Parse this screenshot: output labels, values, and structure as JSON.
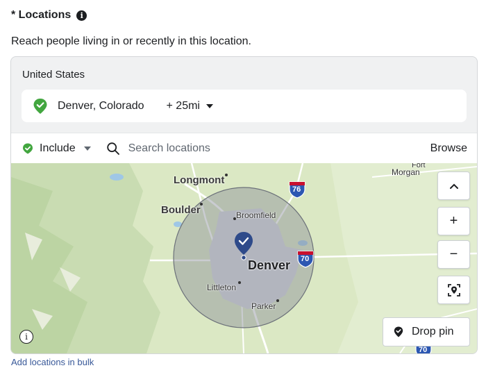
{
  "header": {
    "title": "* Locations",
    "info_glyph": "i"
  },
  "subtitle": "Reach people living in or recently in this location.",
  "panel": {
    "country": "United States",
    "location": {
      "name": "Denver, Colorado",
      "radius": "+ 25mi",
      "pin_color": "#42a63f"
    },
    "toolbar": {
      "include_label": "Include",
      "search_placeholder": "Search locations",
      "browse_label": "Browse"
    }
  },
  "map": {
    "labels": {
      "longmont": "Longmont",
      "boulder": "Boulder",
      "broomfield": "Broomfield",
      "denver": "Denver",
      "littleton": "Littleton",
      "parker": "Parker",
      "fort": "Fort",
      "morgan": "Morgan",
      "i76": "76",
      "i70": "70",
      "i70b": "70"
    },
    "controls": {
      "collapse": "⌃",
      "zoom_in": "+",
      "zoom_out": "−",
      "drop_pin": "Drop pin",
      "info": "i"
    },
    "colors": {
      "land": "#dbe8c4",
      "radius_fill": "#8a8f98",
      "marker": "#2e4a8a"
    }
  },
  "footer": {
    "bulk_link": "Add locations in bulk"
  }
}
